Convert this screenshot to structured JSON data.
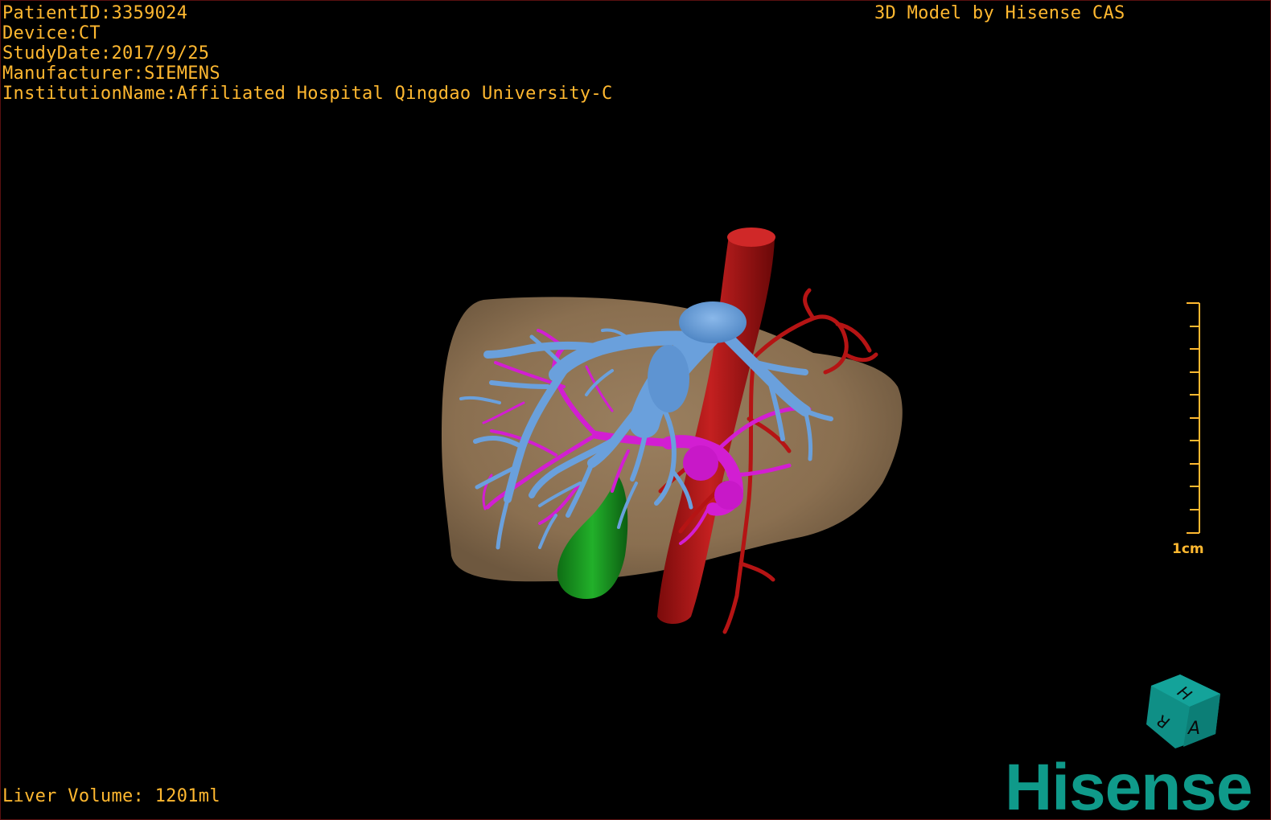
{
  "patient_info": {
    "patient_id": "PatientID:3359024",
    "device": "Device:CT",
    "study_date": "StudyDate:2017/9/25",
    "manufacturer": "Manufacturer:SIEMENS",
    "institution": "InstitutionName:Affiliated Hospital Qingdao University-C"
  },
  "model_credit": "3D Model by Hisense CAS",
  "liver_volume": "Liver Volume: 1201ml",
  "scale_ruler": {
    "label": "1cm"
  },
  "orientation_cube": {
    "face_letters": [
      "H",
      "R",
      "A"
    ],
    "color": "#0f8f86"
  },
  "brand_logo": "Hisense",
  "colors": {
    "overlay_text": "#ffb830",
    "liver": "#8f7556",
    "portal_vein": "#6aa0dc",
    "hepatic_vein": "#d21ed2",
    "artery_ivc": "#b01515",
    "gallbladder": "#1a9a22",
    "brand": "#0f9a8a"
  }
}
